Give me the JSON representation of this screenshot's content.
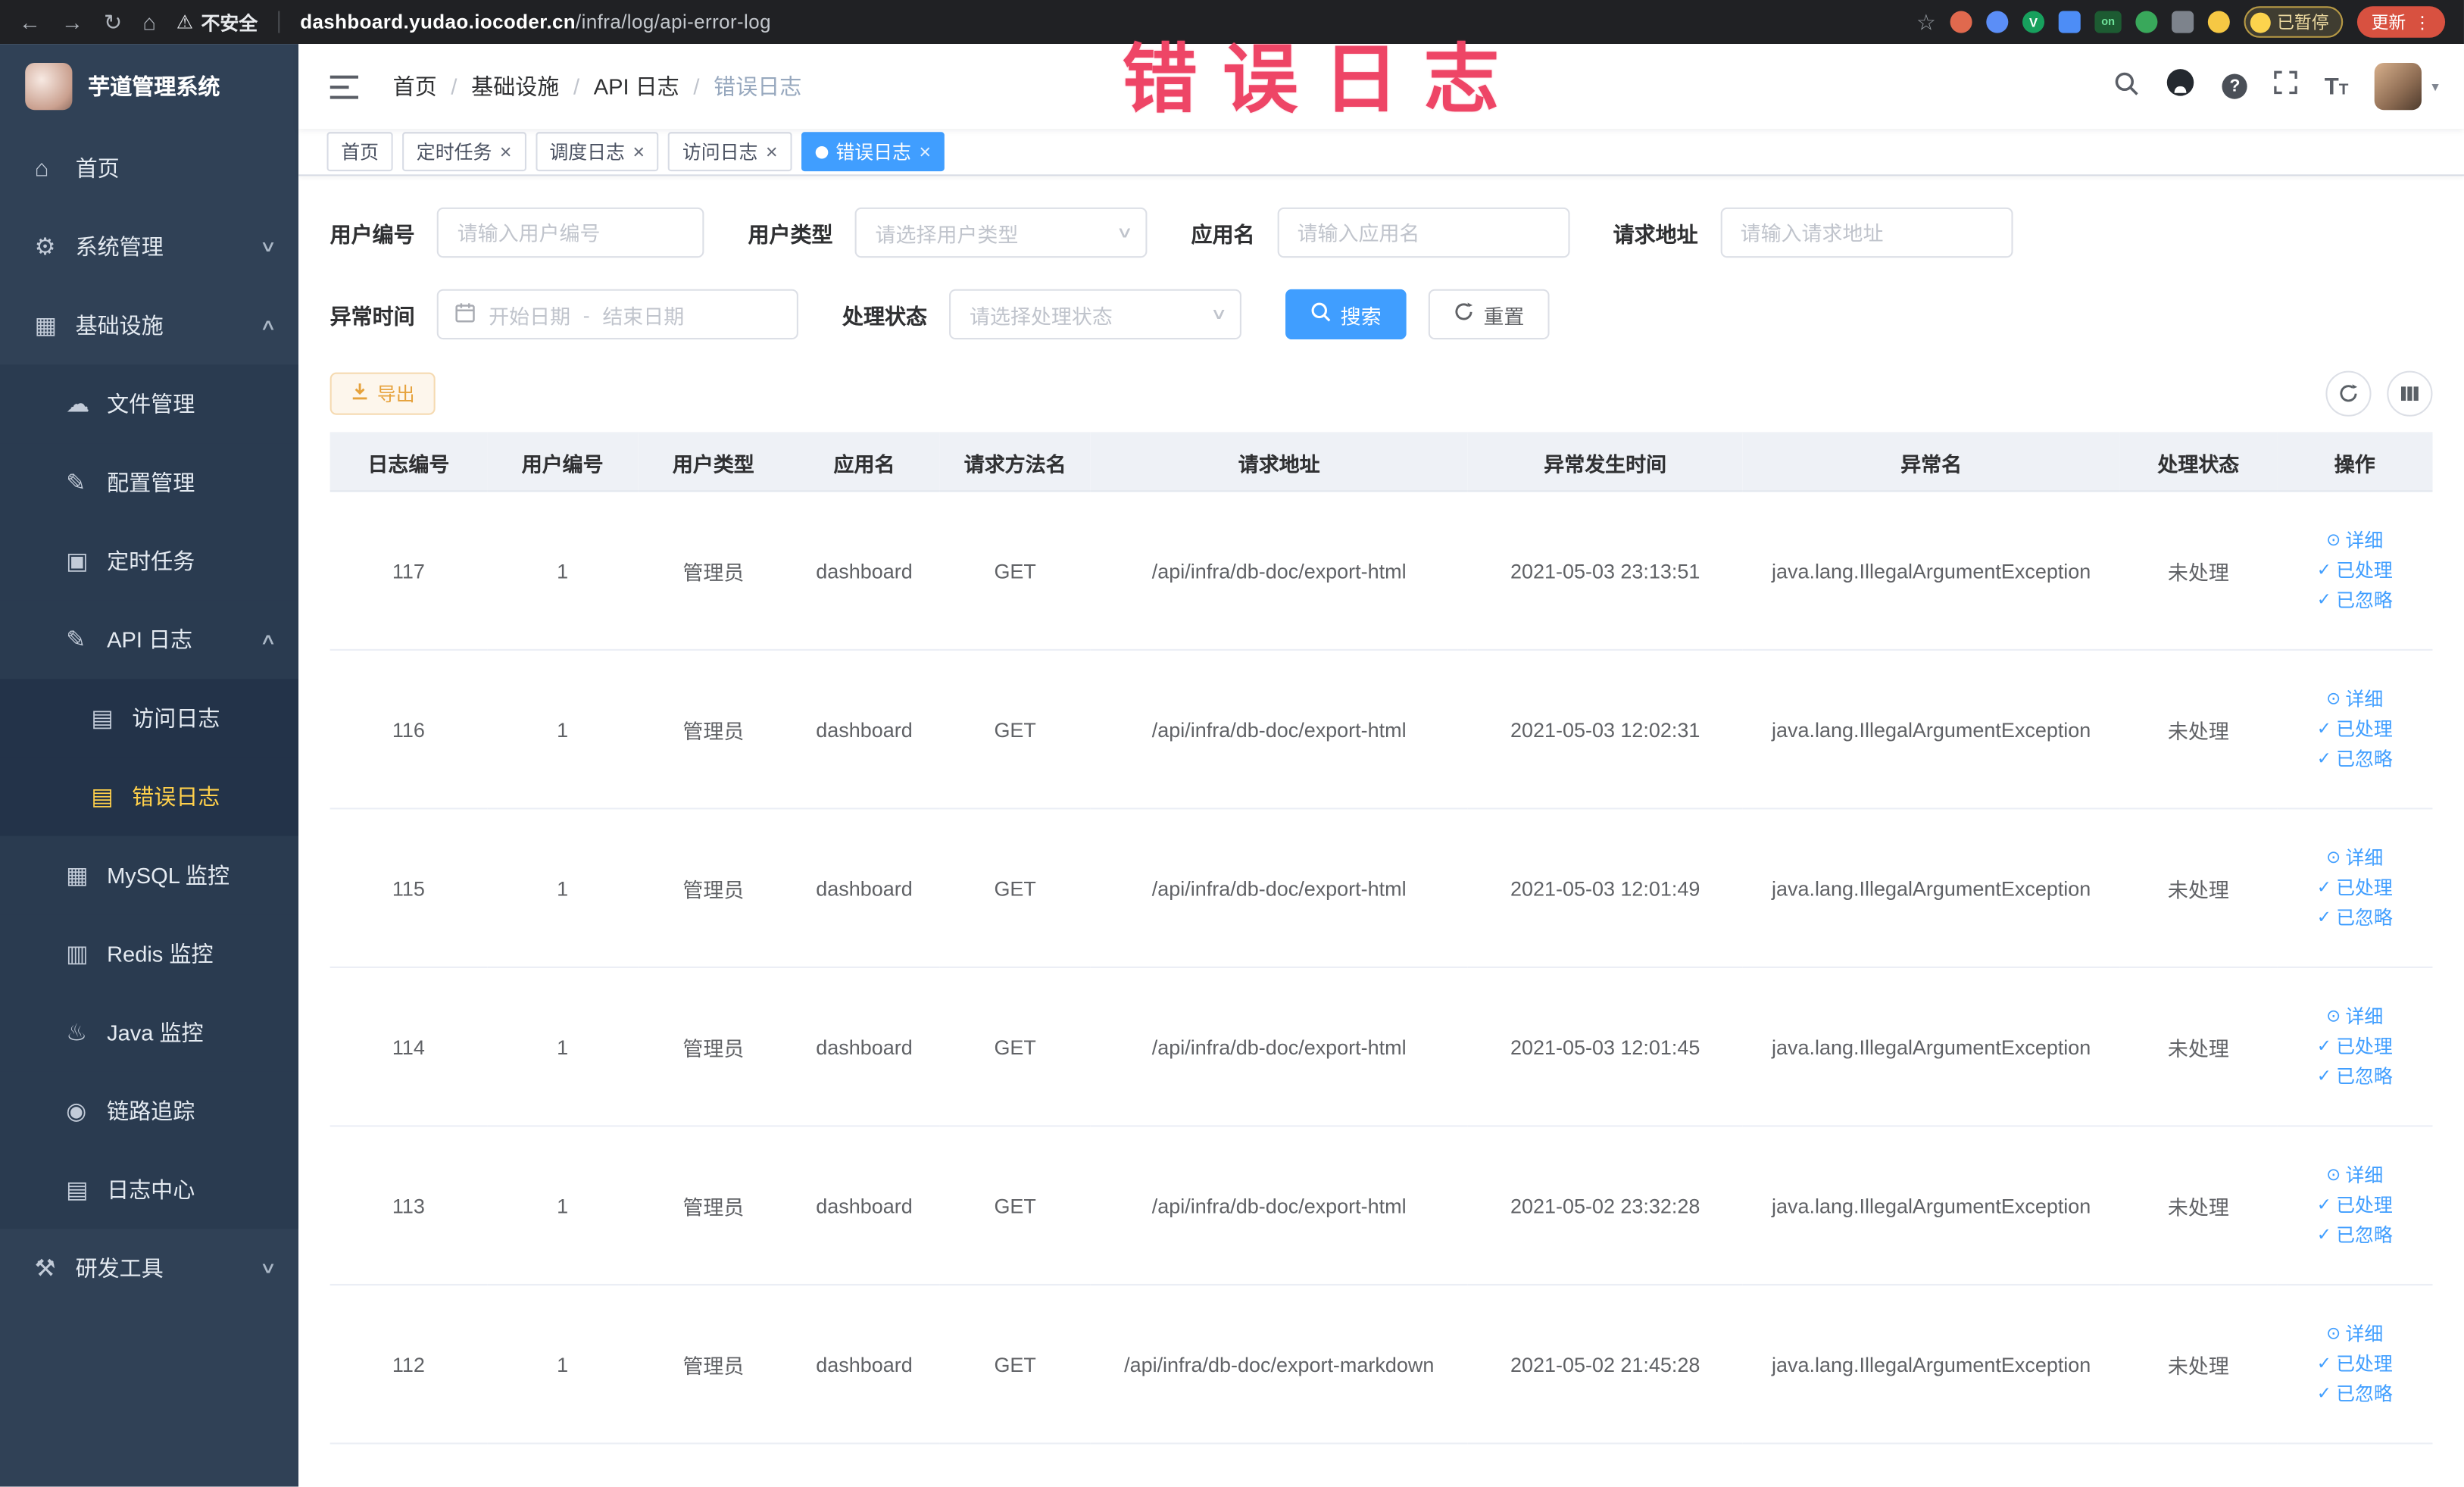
{
  "colors": {
    "accent": "#409eff",
    "sidebar_bg": "#304156",
    "submenu_bg": "#2a3b50",
    "subsubmenu_bg": "#233349",
    "menu_active_text": "#ffd04b",
    "watermark": "#ee4566",
    "warning_text": "#e6a23c",
    "update_button_bg": "#d85140"
  },
  "browser": {
    "security_warning": "不安全",
    "url_domain": "dashboard.yudao.iocoder.cn",
    "url_path": "/infra/log/api-error-log",
    "on_badge": "on",
    "paused_badge": "已暂停",
    "update_button": "更新"
  },
  "watermark": "错误日志",
  "sidebar": {
    "logo_title": "芋道管理系统",
    "menu": [
      {
        "id": "home",
        "label": "首页",
        "icon": "home-icon",
        "level": 0
      },
      {
        "id": "system",
        "label": "系统管理",
        "icon": "gear-icon",
        "level": 0,
        "arrow": "down"
      },
      {
        "id": "infrastructure",
        "label": "基础设施",
        "icon": "infra-icon",
        "level": 0,
        "arrow": "up"
      },
      {
        "id": "file-management",
        "label": "文件管理",
        "icon": "cloud-icon",
        "level": 1
      },
      {
        "id": "config-management",
        "label": "配置管理",
        "icon": "edit-icon",
        "level": 1
      },
      {
        "id": "scheduled-jobs",
        "label": "定时任务",
        "icon": "timer-icon",
        "level": 1
      },
      {
        "id": "api-logs",
        "label": "API 日志",
        "icon": "api-log-icon",
        "level": 1,
        "arrow": "up"
      },
      {
        "id": "access-log",
        "label": "访问日志",
        "icon": "doc-icon",
        "level": 2
      },
      {
        "id": "error-log",
        "label": "错误日志",
        "icon": "doc-icon",
        "level": 2,
        "active": true
      },
      {
        "id": "mysql-monitor",
        "label": "MySQL 监控",
        "icon": "mysql-icon",
        "level": 1
      },
      {
        "id": "redis-monitor",
        "label": "Redis 监控",
        "icon": "redis-icon",
        "level": 1
      },
      {
        "id": "java-monitor",
        "label": "Java 监控",
        "icon": "java-icon",
        "level": 1
      },
      {
        "id": "trace",
        "label": "链路追踪",
        "icon": "eye-icon",
        "level": 1
      },
      {
        "id": "log-center",
        "label": "日志中心",
        "icon": "doc-icon",
        "level": 1
      },
      {
        "id": "dev-tools",
        "label": "研发工具",
        "icon": "tools-icon",
        "level": 0,
        "arrow": "down"
      }
    ]
  },
  "breadcrumb": [
    "首页",
    "基础设施",
    "API 日志",
    "错误日志"
  ],
  "tabs": [
    {
      "id": "home",
      "label": "首页",
      "closable": false,
      "active": false
    },
    {
      "id": "scheduled-jobs",
      "label": "定时任务",
      "closable": true,
      "active": false
    },
    {
      "id": "job-log",
      "label": "调度日志",
      "closable": true,
      "active": false
    },
    {
      "id": "access-log",
      "label": "访问日志",
      "closable": true,
      "active": false
    },
    {
      "id": "error-log",
      "label": "错误日志",
      "closable": true,
      "active": true
    }
  ],
  "filters": {
    "user_id": {
      "label": "用户编号",
      "placeholder": "请输入用户编号"
    },
    "user_type": {
      "label": "用户类型",
      "placeholder": "请选择用户类型"
    },
    "app_name": {
      "label": "应用名",
      "placeholder": "请输入应用名"
    },
    "request_url": {
      "label": "请求地址",
      "placeholder": "请输入请求地址"
    },
    "exception_time": {
      "label": "异常时间",
      "start_placeholder": "开始日期",
      "range_separator": "-",
      "end_placeholder": "结束日期"
    },
    "process_status": {
      "label": "处理状态",
      "placeholder": "请选择处理状态"
    },
    "search_button": "搜索",
    "reset_button": "重置"
  },
  "toolbar": {
    "export_button": "导出"
  },
  "table": {
    "columns": [
      "日志编号",
      "用户编号",
      "用户类型",
      "应用名",
      "请求方法名",
      "请求地址",
      "异常发生时间",
      "异常名",
      "处理状态",
      "操作"
    ],
    "actions": [
      "详细",
      "已处理",
      "已忽略"
    ],
    "rows": [
      {
        "id": "117",
        "user_id": "1",
        "user_type": "管理员",
        "app": "dashboard",
        "method": "GET",
        "url": "/api/infra/db-doc/export-html",
        "time": "2021-05-03 23:13:51",
        "exception": "java.lang.IllegalArgumentException",
        "status": "未处理"
      },
      {
        "id": "116",
        "user_id": "1",
        "user_type": "管理员",
        "app": "dashboard",
        "method": "GET",
        "url": "/api/infra/db-doc/export-html",
        "time": "2021-05-03 12:02:31",
        "exception": "java.lang.IllegalArgumentException",
        "status": "未处理"
      },
      {
        "id": "115",
        "user_id": "1",
        "user_type": "管理员",
        "app": "dashboard",
        "method": "GET",
        "url": "/api/infra/db-doc/export-html",
        "time": "2021-05-03 12:01:49",
        "exception": "java.lang.IllegalArgumentException",
        "status": "未处理"
      },
      {
        "id": "114",
        "user_id": "1",
        "user_type": "管理员",
        "app": "dashboard",
        "method": "GET",
        "url": "/api/infra/db-doc/export-html",
        "time": "2021-05-03 12:01:45",
        "exception": "java.lang.IllegalArgumentException",
        "status": "未处理"
      },
      {
        "id": "113",
        "user_id": "1",
        "user_type": "管理员",
        "app": "dashboard",
        "method": "GET",
        "url": "/api/infra/db-doc/export-html",
        "time": "2021-05-02 23:32:28",
        "exception": "java.lang.IllegalArgumentException",
        "status": "未处理"
      },
      {
        "id": "112",
        "user_id": "1",
        "user_type": "管理员",
        "app": "dashboard",
        "method": "GET",
        "url": "/api/infra/db-doc/export-markdown",
        "time": "2021-05-02 21:45:28",
        "exception": "java.lang.IllegalArgumentException",
        "status": "未处理"
      }
    ]
  }
}
